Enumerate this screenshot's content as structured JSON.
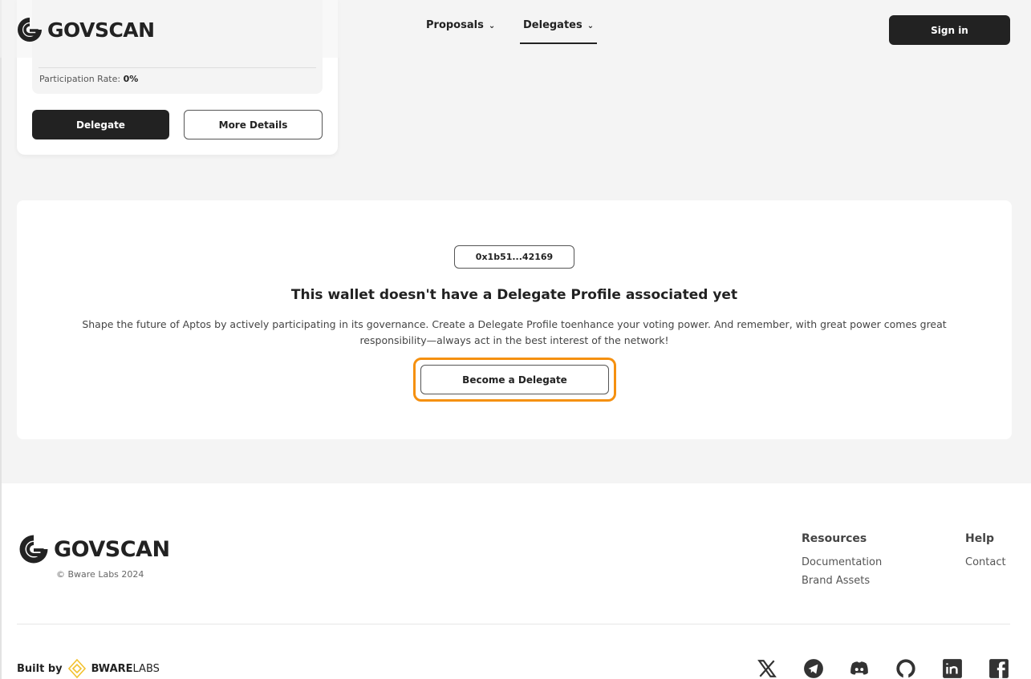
{
  "header": {
    "logo": "GOVSCAN",
    "nav": [
      {
        "label": "Proposals"
      },
      {
        "label": "Delegates"
      }
    ],
    "sign_in": "Sign in"
  },
  "delegate_card": {
    "participation_label": "Participation Rate:",
    "participation_value": "0%",
    "delegate_button": "Delegate",
    "details_button": "More Details"
  },
  "empty_state": {
    "address": "0x1b51...42169",
    "title": "This wallet doesn't have a Delegate Profile associated yet",
    "description": "Shape the future of Aptos by actively participating in its governance. Create a Delegate Profile toenhance your voting power. And remember, with great power comes great responsibility—always act in the best interest of the network!",
    "button": "Become a Delegate",
    "highlight_color": "#f5900f"
  },
  "footer": {
    "logo": "GOVSCAN",
    "copyright": "© Bware Labs 2024",
    "resources": {
      "title": "Resources",
      "links": [
        "Documentation",
        "Brand Assets"
      ]
    },
    "help": {
      "title": "Help",
      "links": [
        "Contact"
      ]
    },
    "built_by": "Built by",
    "brand": "BWARE",
    "brand_suffix": "LABS",
    "social": [
      "x-icon",
      "telegram-icon",
      "discord-icon",
      "github-icon",
      "linkedin-icon",
      "facebook-icon"
    ]
  }
}
